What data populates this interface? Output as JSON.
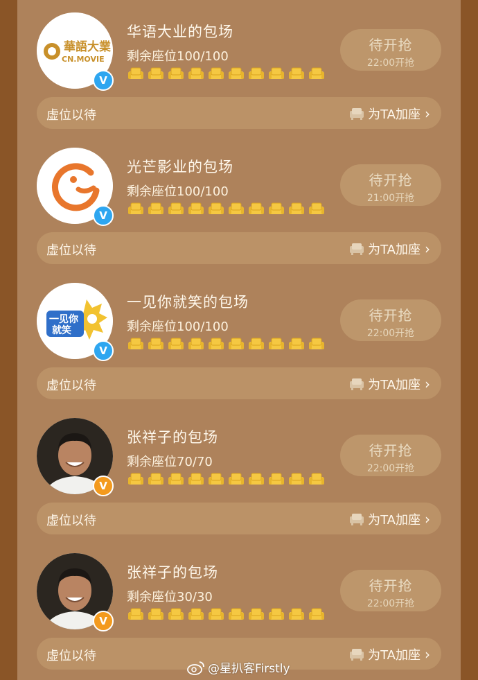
{
  "items": [
    {
      "title": "华语大业的包场",
      "seats": "剩余座位100/100",
      "button": "待开抢",
      "time": "22:00开抢",
      "bar_label": "虚位以待",
      "add_seat": "为TA加座",
      "avatar": "cn-movie-logo",
      "badge": "blue",
      "logo_cn": "華語大業",
      "logo_en": "CN.MOVIE"
    },
    {
      "title": "光芒影业的包场",
      "seats": "剩余座位100/100",
      "button": "待开抢",
      "time": "21:00开抢",
      "bar_label": "虚位以待",
      "add_seat": "为TA加座",
      "avatar": "guangmang-logo",
      "badge": "blue"
    },
    {
      "title": "一见你就笑的包场",
      "seats": "剩余座位100/100",
      "button": "待开抢",
      "time": "22:00开抢",
      "bar_label": "虚位以待",
      "add_seat": "为TA加座",
      "avatar": "yijian-logo",
      "badge": "blue",
      "logo_line1": "一见你",
      "logo_line2": "就笑"
    },
    {
      "title": "张祥子的包场",
      "seats": "剩余座位70/70",
      "button": "待开抢",
      "time": "22:00开抢",
      "bar_label": "虚位以待",
      "add_seat": "为TA加座",
      "avatar": "person-photo",
      "badge": "orange"
    },
    {
      "title": "张祥子的包场",
      "seats": "剩余座位30/30",
      "button": "待开抢",
      "time": "22:00开抢",
      "bar_label": "虚位以待",
      "add_seat": "为TA加座",
      "avatar": "person-photo",
      "badge": "orange"
    }
  ],
  "watermark": "@星扒客Firstly",
  "colors": {
    "background": "#8a5527",
    "panel": "#ae825b",
    "bar": "#bb9267",
    "button": "#bd966b",
    "seat": "#f5c842",
    "badge_blue": "#2ea6f0",
    "badge_orange": "#f39a1e"
  }
}
